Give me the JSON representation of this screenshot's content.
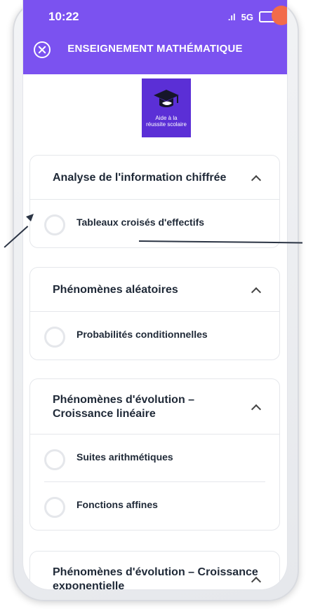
{
  "status_bar": {
    "time": "10:22",
    "network": "5G"
  },
  "header": {
    "title": "ENSEIGNEMENT MATHÉMATIQUE"
  },
  "logo": {
    "line1": "Aide à la",
    "line2": "réussite scolaire"
  },
  "sections": [
    {
      "title": "Analyse de l'information chiffrée",
      "items": [
        "Tableaux croisés d'effectifs"
      ]
    },
    {
      "title": "Phénomènes aléatoires",
      "items": [
        "Probabilités conditionnelles"
      ]
    },
    {
      "title_line1": "Phénomènes d'évolution –",
      "title_line2": "Croissance linéaire",
      "items": [
        "Suites arithmétiques",
        "Fonctions affines"
      ]
    },
    {
      "title_line1": "Phénomènes d'évolution – Croissance",
      "title_line2": "exponentielle",
      "items": []
    }
  ],
  "colors": {
    "accent": "#7b52f0",
    "logo_bg": "#5b2fd6",
    "border": "#e5e7eb"
  }
}
